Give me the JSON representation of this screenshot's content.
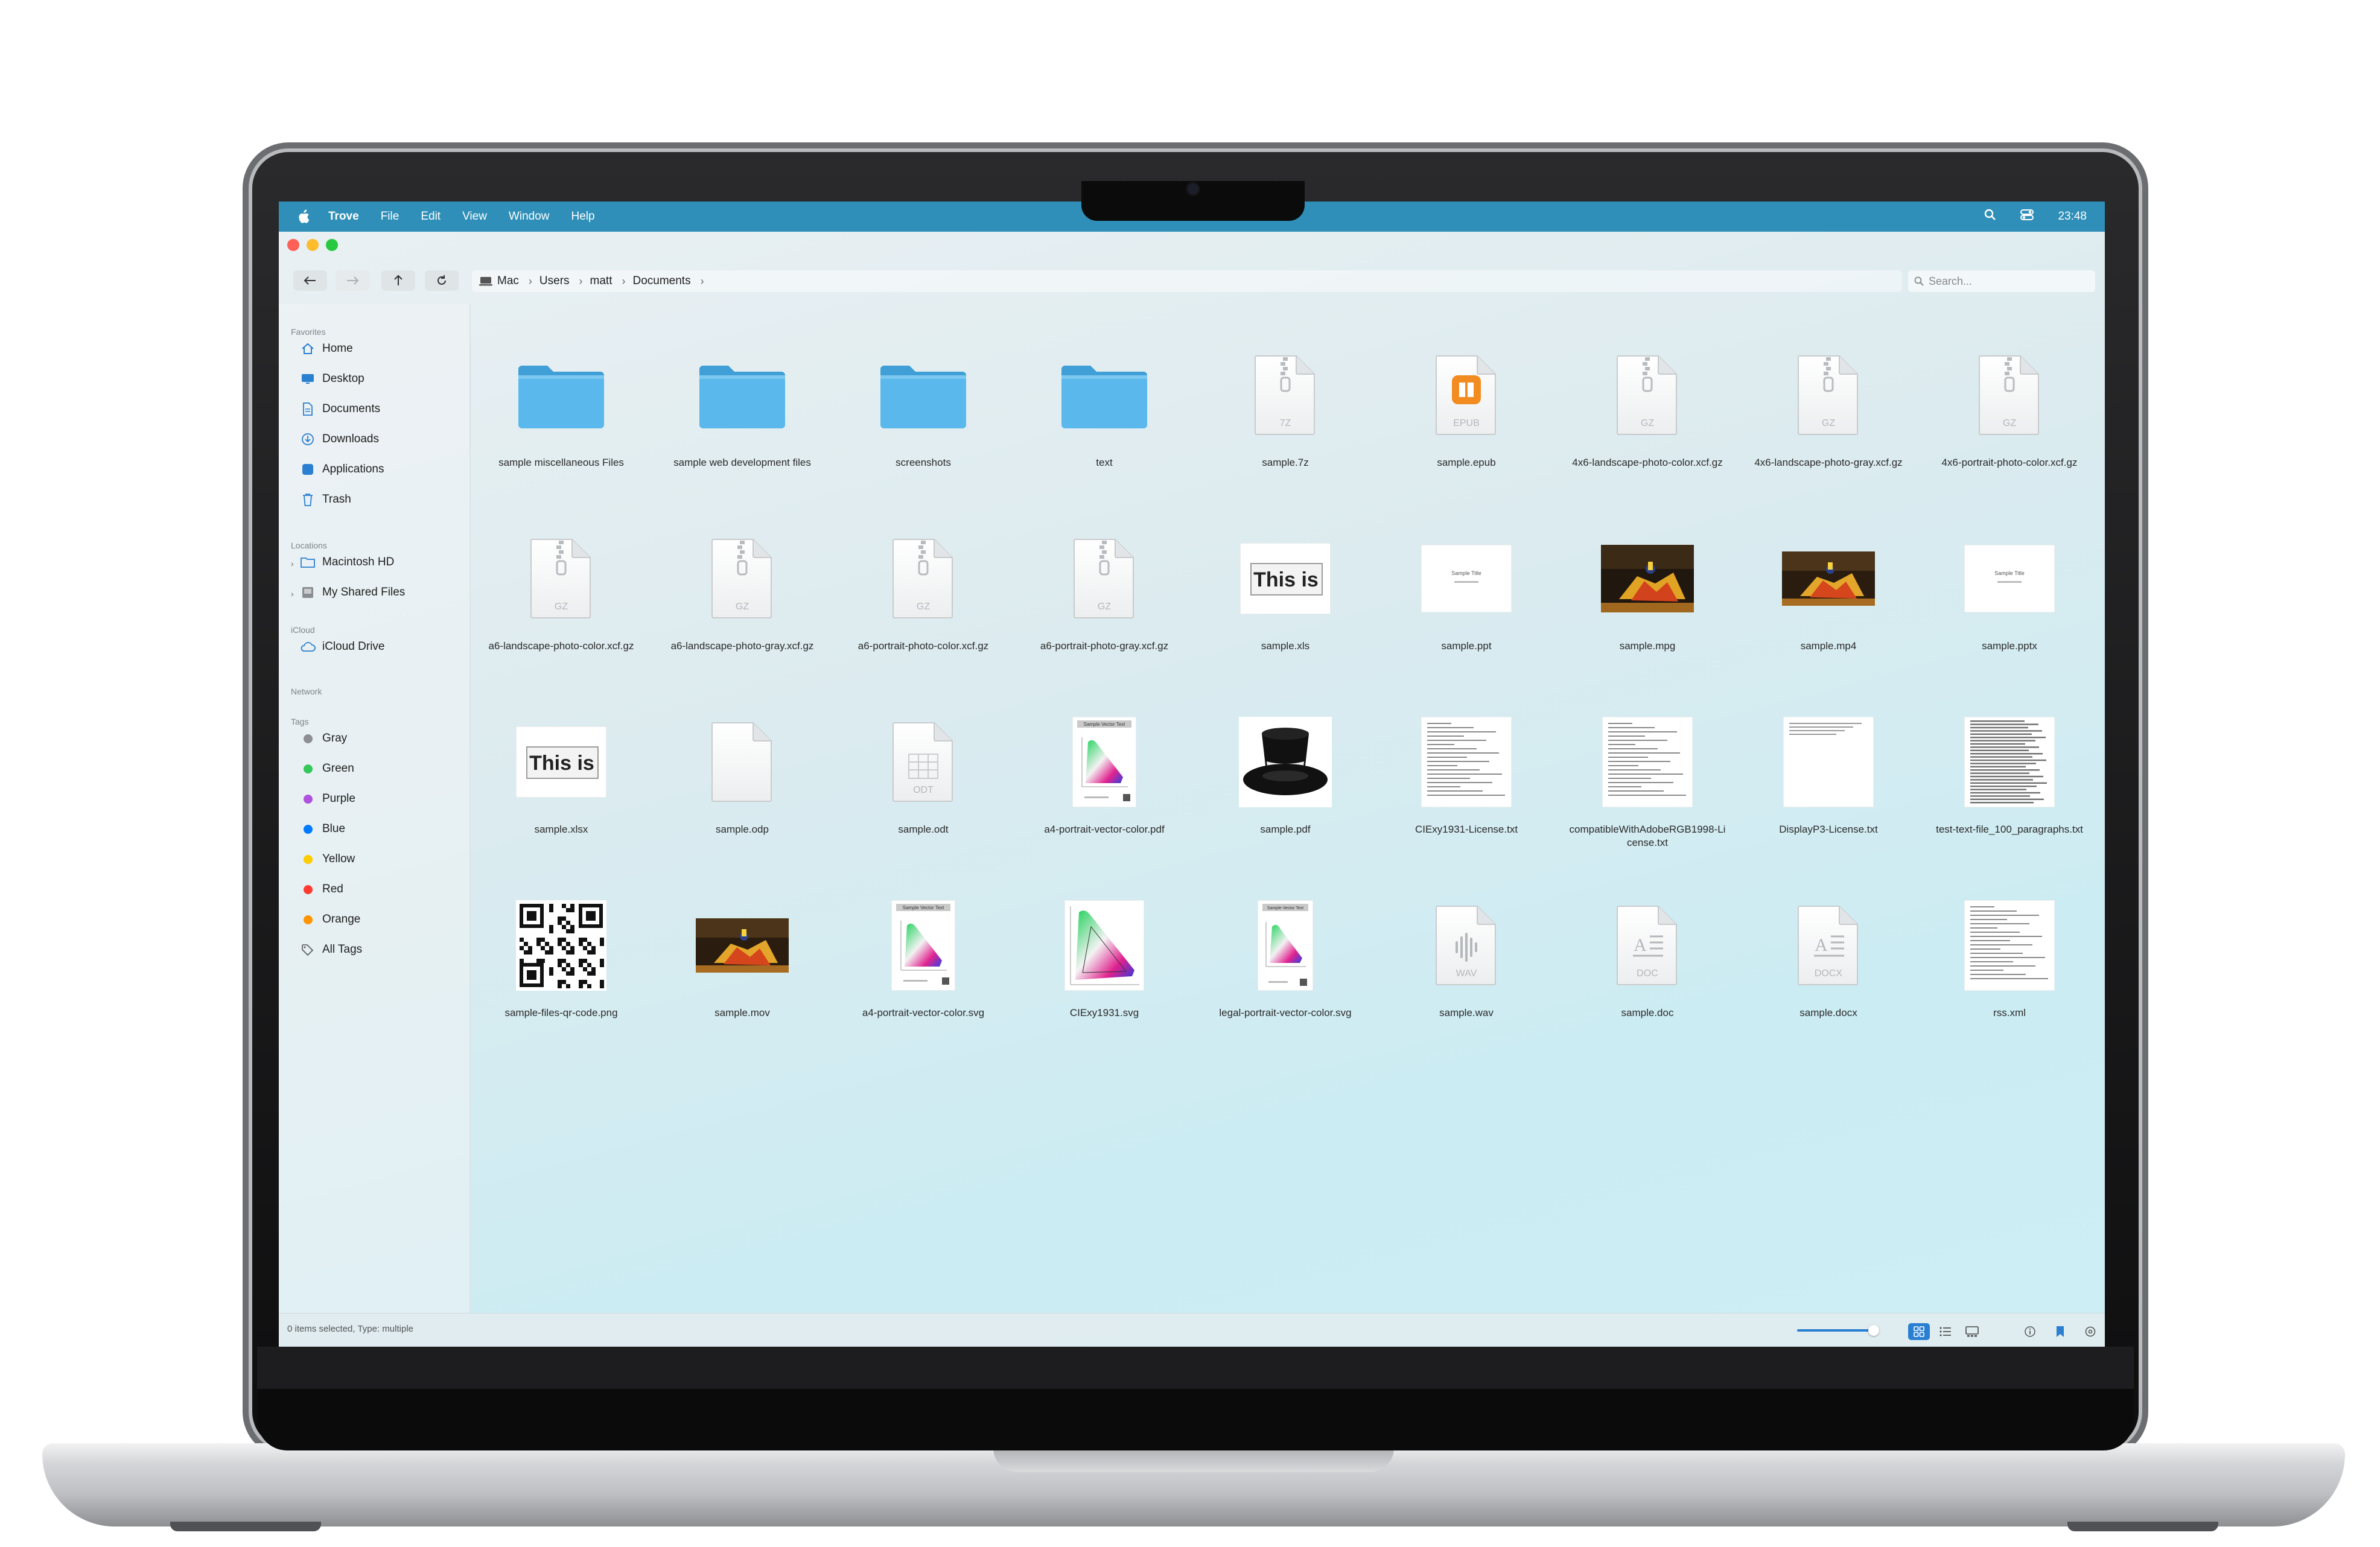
{
  "menubar": {
    "app": "Trove",
    "items": [
      "File",
      "Edit",
      "View",
      "Window",
      "Help"
    ],
    "clock": "23:48"
  },
  "path": {
    "crumbs": [
      "Mac",
      "Users",
      "matt",
      "Documents"
    ]
  },
  "search": {
    "placeholder": "Search..."
  },
  "sidebar": {
    "favorites_title": "Favorites",
    "favorites": [
      "Home",
      "Desktop",
      "Documents",
      "Downloads",
      "Applications",
      "Trash"
    ],
    "locations_title": "Locations",
    "locations": [
      "Macintosh HD",
      "My Shared Files"
    ],
    "icloud_title": "iCloud",
    "icloud": [
      "iCloud Drive"
    ],
    "network_title": "Network",
    "tags_title": "Tags",
    "tags": [
      {
        "label": "Gray",
        "color": "#8e8e93"
      },
      {
        "label": "Green",
        "color": "#34c759"
      },
      {
        "label": "Purple",
        "color": "#af52de"
      },
      {
        "label": "Blue",
        "color": "#007aff"
      },
      {
        "label": "Yellow",
        "color": "#ffcc00"
      },
      {
        "label": "Red",
        "color": "#ff3b30"
      },
      {
        "label": "Orange",
        "color": "#ff9500"
      }
    ],
    "all_tags": "All Tags"
  },
  "files": [
    {
      "name": "sample miscellaneous Files",
      "kind": "folder"
    },
    {
      "name": "sample web development files",
      "kind": "folder"
    },
    {
      "name": "screenshots",
      "kind": "folder"
    },
    {
      "name": "text",
      "kind": "folder"
    },
    {
      "name": "sample.7z",
      "kind": "archive",
      "badge": "7Z"
    },
    {
      "name": "sample.epub",
      "kind": "epub",
      "badge": "EPUB"
    },
    {
      "name": "4x6-landscape-photo-color.xcf.gz",
      "kind": "archive",
      "badge": "GZ"
    },
    {
      "name": "4x6-landscape-photo-gray.xcf.gz",
      "kind": "archive",
      "badge": "GZ"
    },
    {
      "name": "4x6-portrait-photo-color.xcf.gz",
      "kind": "archive",
      "badge": "GZ"
    },
    {
      "name": "a6-landscape-photo-color.xcf.gz",
      "kind": "archive",
      "badge": "GZ"
    },
    {
      "name": "a6-landscape-photo-gray.xcf.gz",
      "kind": "archive",
      "badge": "GZ"
    },
    {
      "name": "a6-portrait-photo-color.xcf.gz",
      "kind": "archive",
      "badge": "GZ"
    },
    {
      "name": "a6-portrait-photo-gray.xcf.gz",
      "kind": "archive",
      "badge": "GZ"
    },
    {
      "name": "sample.xls",
      "kind": "thisis",
      "badge": "This is"
    },
    {
      "name": "sample.ppt",
      "kind": "slide",
      "badge": "Sample Title"
    },
    {
      "name": "sample.mpg",
      "kind": "photo"
    },
    {
      "name": "sample.mp4",
      "kind": "photo-small"
    },
    {
      "name": "sample.pptx",
      "kind": "slide",
      "badge": "Sample Title"
    },
    {
      "name": "sample.xlsx",
      "kind": "thisis",
      "badge": "This is"
    },
    {
      "name": "sample.odp",
      "kind": "blank"
    },
    {
      "name": "sample.odt",
      "kind": "odt",
      "badge": "ODT"
    },
    {
      "name": "a4-portrait-vector-color.pdf",
      "kind": "chroma-page"
    },
    {
      "name": "sample.pdf",
      "kind": "tophat"
    },
    {
      "name": "CIExy1931-License.txt",
      "kind": "text-doc"
    },
    {
      "name": "compatibleWithAdobeRGB1998-License.txt",
      "kind": "text-doc"
    },
    {
      "name": "DisplayP3-License.txt",
      "kind": "text-doc-light"
    },
    {
      "name": "test-text-file_100_paragraphs.txt",
      "kind": "text-dense"
    },
    {
      "name": "sample-files-qr-code.png",
      "kind": "qr"
    },
    {
      "name": "sample.mov",
      "kind": "photo-small"
    },
    {
      "name": "a4-portrait-vector-color.svg",
      "kind": "chroma-page"
    },
    {
      "name": "CIExy1931.svg",
      "kind": "chroma"
    },
    {
      "name": "legal-portrait-vector-color.svg",
      "kind": "chroma-page-narrow"
    },
    {
      "name": "sample.wav",
      "kind": "audio",
      "badge": "WAV"
    },
    {
      "name": "sample.doc",
      "kind": "doc",
      "badge": "DOC"
    },
    {
      "name": "sample.docx",
      "kind": "doc",
      "badge": "DOCX"
    },
    {
      "name": "rss.xml",
      "kind": "text-doc"
    }
  ],
  "status": {
    "text": "0 items selected, Type: multiple",
    "zoom_level": 0.95
  },
  "colors": {
    "menubar": "#2f8fb8",
    "accent": "#2a7fd1",
    "folder": "#5ab8ec"
  }
}
